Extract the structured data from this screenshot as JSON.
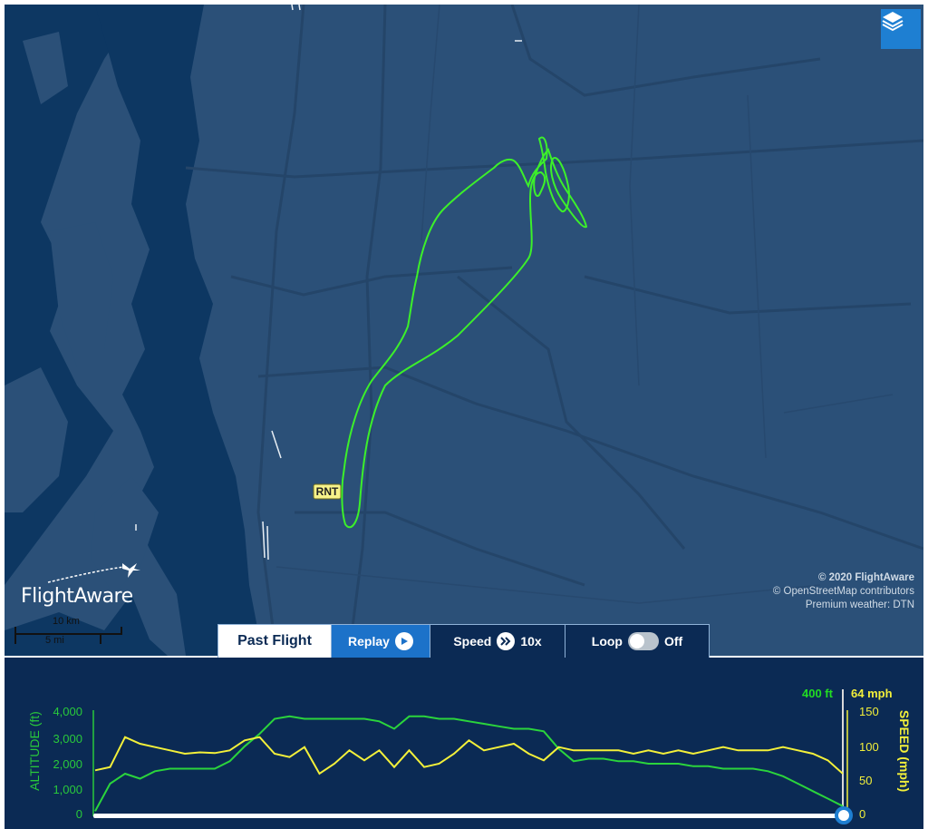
{
  "map": {
    "airport_label": "RNT",
    "logo_text": "FlightAware",
    "scale": {
      "km": "10 km",
      "mi": "5 mi"
    },
    "attribution": [
      "© 2020 FlightAware",
      "© OpenStreetMap contributors",
      "Premium weather: DTN"
    ],
    "colors": {
      "water": "#0d3762",
      "land": "#2b5078",
      "track": "#3cf02a",
      "roads": "#25476c"
    },
    "layers_icon": "layers-icon"
  },
  "controls": {
    "past_flight": "Past Flight",
    "replay": "Replay",
    "speed": "Speed",
    "speed_value": "10x",
    "loop": "Loop",
    "loop_state": "Off"
  },
  "graph": {
    "current_altitude": "400 ft",
    "current_speed": "64 mph",
    "altitude_title": "ALTITUDE (ft)",
    "speed_title": "SPEED (mph)",
    "altitude_ticks": [
      "4,000",
      "3,000",
      "2,000",
      "1,000",
      "0"
    ],
    "speed_ticks": [
      "150",
      "100",
      "50",
      "0"
    ],
    "colors": {
      "altitude": "#2bd43c",
      "speed": "#f3f03a",
      "background": "#0b2a54"
    }
  },
  "chart_data": {
    "type": "line",
    "xlabel": "",
    "y_left_label": "ALTITUDE (ft)",
    "y_right_label": "SPEED (mph)",
    "ylim_left": [
      0,
      4000
    ],
    "ylim_right": [
      0,
      150
    ],
    "x": [
      0,
      1,
      2,
      3,
      4,
      5,
      6,
      7,
      8,
      9,
      10,
      11,
      12,
      13,
      14,
      15,
      16,
      17,
      18,
      19,
      20,
      21,
      22,
      23,
      24,
      25,
      26,
      27,
      28,
      29,
      30,
      31,
      32,
      33,
      34,
      35,
      36,
      37,
      38,
      39,
      40,
      41,
      42,
      43,
      44,
      45,
      46,
      47,
      48,
      49,
      50
    ],
    "series": [
      {
        "name": "ALTITUDE (ft)",
        "axis": "left",
        "values": [
          100,
          1200,
          1600,
          1400,
          1700,
          1800,
          1800,
          1800,
          1800,
          2100,
          2700,
          3200,
          3800,
          3900,
          3800,
          3800,
          3800,
          3800,
          3800,
          3700,
          3400,
          3900,
          3900,
          3800,
          3800,
          3700,
          3600,
          3500,
          3400,
          3400,
          3300,
          2600,
          2100,
          2200,
          2200,
          2100,
          2100,
          2000,
          2000,
          2000,
          1900,
          1900,
          1800,
          1800,
          1800,
          1700,
          1500,
          1200,
          900,
          600,
          300
        ]
      },
      {
        "name": "SPEED (mph)",
        "axis": "right",
        "values": [
          65,
          70,
          115,
          105,
          100,
          95,
          90,
          92,
          91,
          95,
          110,
          115,
          90,
          85,
          100,
          60,
          75,
          95,
          80,
          95,
          70,
          95,
          70,
          75,
          90,
          110,
          95,
          100,
          105,
          90,
          80,
          100,
          95,
          95,
          95,
          95,
          90,
          95,
          90,
          95,
          90,
          95,
          100,
          95,
          95,
          95,
          100,
          95,
          90,
          80,
          60
        ]
      }
    ]
  }
}
